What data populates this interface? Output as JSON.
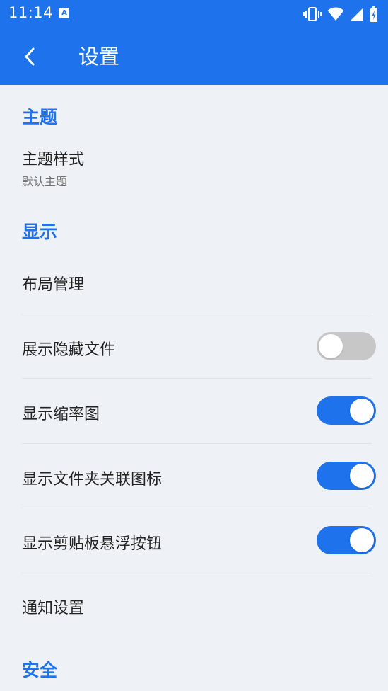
{
  "status_bar": {
    "time": "11:14",
    "app_icon_letter": "A",
    "icons": [
      "vibrate-icon",
      "wifi-icon",
      "signal-icon",
      "battery-icon"
    ]
  },
  "app_bar": {
    "title": "设置",
    "back_icon": "chevron-left-icon"
  },
  "sections": {
    "theme": {
      "header": "主题",
      "item_title": "主题样式",
      "item_subtitle": "默认主题"
    },
    "display": {
      "header": "显示",
      "layout_manage": "布局管理",
      "show_hidden_files": {
        "label": "展示隐藏文件",
        "enabled": false
      },
      "show_thumbnails": {
        "label": "显示缩率图",
        "enabled": true
      },
      "show_folder_icons": {
        "label": "显示文件夹关联图标",
        "enabled": true
      },
      "show_clipboard_button": {
        "label": "显示剪贴板悬浮按钮",
        "enabled": true
      },
      "notification_settings": "通知设置"
    },
    "security": {
      "header": "安全"
    }
  },
  "colors": {
    "accent": "#1e72ec",
    "background": "#eef2f6",
    "switch_off": "#c7c7c7"
  }
}
